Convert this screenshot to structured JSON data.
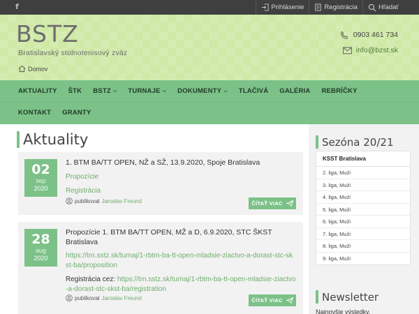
{
  "topbar": {
    "facebook": "f",
    "login": "Prihlásenie",
    "register": "Registrácia",
    "search": "Hľadať"
  },
  "header": {
    "logo": "BSTZ",
    "tagline": "Bratislavský stolnotenisový zväz",
    "home": "Domov",
    "phone": "0903 461 734",
    "email": "info@bzst.sk"
  },
  "nav": {
    "row1": [
      {
        "label": "AKTUALITY",
        "caret": false
      },
      {
        "label": "ŠTK",
        "caret": false
      },
      {
        "label": "BSTZ",
        "caret": true
      },
      {
        "label": "TURNAJE",
        "caret": true
      },
      {
        "label": "DOKUMENTY",
        "caret": true
      },
      {
        "label": "TLAČIVÁ",
        "caret": false
      },
      {
        "label": "GALÉRIA",
        "caret": false
      },
      {
        "label": "REBRÍČKY",
        "caret": false
      }
    ],
    "row2": [
      {
        "label": "KONTAKT",
        "caret": false
      },
      {
        "label": "GRANTY",
        "caret": false
      }
    ]
  },
  "main": {
    "title": "Aktuality",
    "posts": [
      {
        "day": "02",
        "month": "sep",
        "year": "2020",
        "title": "1. BTM BA/TT OPEN, NŽ a SŽ, 13.9.2020, Spoje Bratislava",
        "link1": "Propozície",
        "link2": "Registrácia",
        "author_prefix": "publikoval",
        "author": "Jaroslav Freund",
        "read_more": "ČÍTAŤ VIAC"
      },
      {
        "day": "28",
        "month": "aug",
        "year": "2020",
        "title": "Propozície 1. BTM BA/TT OPEN, MŽ a D, 6.9.2020, STC ŠKST Bratislava",
        "link1": "https://trn.sstz.sk/turnaj/1-rbtm-ba-tt-open-mladsie-ziactvo-a-dorast-stc-skst-ba/proposition",
        "reg_label": "Registrácia cez: ",
        "link2": "https://trn.sstz.sk/turnaj/1-rbtm-ba-tt-open-mladsie-ziactvo-a-dorast-stc-skst-ba/registration",
        "author_prefix": "publikoval",
        "author": "Jaroslav Freund",
        "read_more": "ČÍTAŤ VIAC"
      }
    ]
  },
  "sidebar": {
    "season_title": "Sezóna 20/21",
    "club": "KSST Bratislava",
    "leagues": [
      "2. liga, Muži",
      "3. liga, Muži",
      "4. liga, Muži",
      "5. liga, Muži",
      "6. liga, Muži",
      "7. liga, Muži",
      "8. liga, Muži",
      "9. liga, Muži"
    ],
    "newsletter_title": "Newsletter",
    "newsletter_text": "Najnovšie výsledky,"
  },
  "colors": {
    "accent": "#7cc188",
    "header_bg": "#cfe9a6",
    "topbar_bg": "#3f3f3f",
    "link": "#6fae6d"
  }
}
